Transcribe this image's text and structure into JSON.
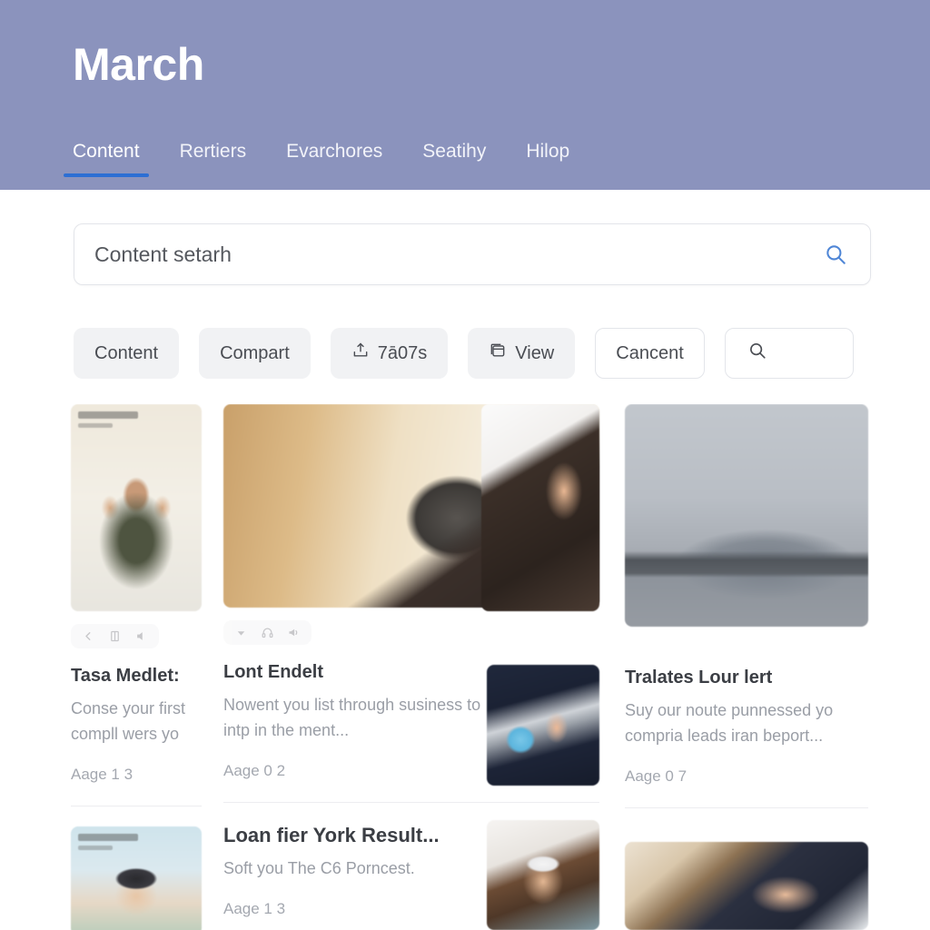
{
  "header": {
    "title": "March",
    "background_color": "#8b93bd",
    "accent_color": "#2d6fd4",
    "tabs": [
      {
        "label": "Content",
        "active": true
      },
      {
        "label": "Rertiers",
        "active": false
      },
      {
        "label": "Evarchores",
        "active": false
      },
      {
        "label": "Seatihy",
        "active": false
      },
      {
        "label": "Hilop",
        "active": false
      }
    ]
  },
  "search": {
    "value": "",
    "placeholder": "Content setarh",
    "icon": "search-icon"
  },
  "chips": [
    {
      "label": "Content",
      "icon": null,
      "style": "filled"
    },
    {
      "label": "Compart",
      "icon": null,
      "style": "filled"
    },
    {
      "label": "7́0 7s",
      "icon": "share-icon",
      "style": "filled"
    },
    {
      "label": "View",
      "icon": "window-icon",
      "style": "filled"
    },
    {
      "label": "Cancent",
      "icon": null,
      "style": "outline"
    },
    {
      "label": "",
      "icon": "search-icon",
      "style": "outline"
    }
  ],
  "cards": [
    {
      "title": "Tasa Medlet:",
      "description": "Conse your first compll wers yo",
      "meta": "Aage 1 3",
      "image": "person-in-room",
      "actions": [
        "back-icon",
        "book-icon",
        "speaker-icon"
      ]
    },
    {
      "title": "Lont Endelt",
      "description": "Nowent you list through susiness to intp in the ment...",
      "meta": "Aage 0 2",
      "image": "hands-with-phone",
      "actions": [
        "down-icon",
        "headphones-icon",
        "megaphone-icon"
      ]
    },
    {
      "title": "Tralates Lour lert",
      "description": "Suy our noute punnessed yo compria leads iran beport...",
      "meta": "Aage 0 7",
      "image": "grey-mountain-lake",
      "actions": []
    },
    {
      "title": "Loan fier York Result...",
      "description": "Soft you The C6 Porncest.",
      "meta": "Aage 1 3",
      "image": "woman-sunglasses",
      "actions": []
    }
  ],
  "chip_labels": {
    "third": "7́0 7s"
  },
  "chip3_text": "7ā07s"
}
